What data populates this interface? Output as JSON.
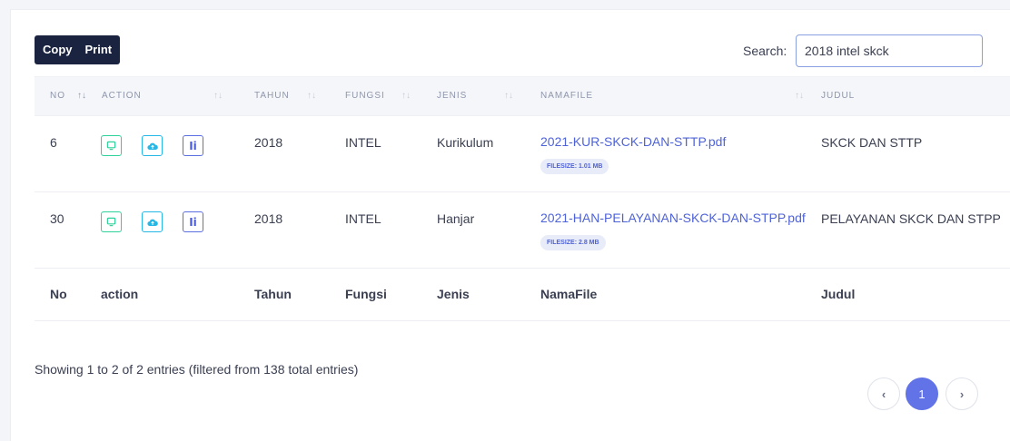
{
  "toolbar": {
    "copy_label": "Copy",
    "print_label": "Print"
  },
  "search": {
    "label": "Search:",
    "value": "2018 intel skck"
  },
  "table": {
    "headers": [
      "NO",
      "ACTION",
      "TAHUN",
      "FUNGSI",
      "JENIS",
      "NAMAFILE",
      "JUDUL"
    ],
    "rows": [
      {
        "no": "6",
        "tahun": "2018",
        "fungsi": "INTEL",
        "jenis": "Kurikulum",
        "namafile": "2021-KUR-SKCK-DAN-STTP.pdf",
        "filesize": "FILESIZE: 1.01 MB",
        "judul": "SKCK DAN STTP"
      },
      {
        "no": "30",
        "tahun": "2018",
        "fungsi": "INTEL",
        "jenis": "Hanjar",
        "namafile": "2021-HAN-PELAYANAN-SKCK-DAN-STPP.pdf",
        "filesize": "FILESIZE: 2.8 MB",
        "judul": "PELAYANAN SKCK DAN STPP"
      }
    ],
    "footer": [
      "No",
      "action",
      "Tahun",
      "Fungsi",
      "Jenis",
      "NamaFile",
      "Judul"
    ],
    "action_icons": [
      "monitor-icon",
      "cloud-icon",
      "info-icon"
    ],
    "info_glyph": "Ii"
  },
  "info_text": "Showing 1 to 2 of 2 entries (filtered from 138 total entries)",
  "pagination": {
    "prev": "‹",
    "current": "1",
    "next": "›"
  },
  "colors": {
    "accent": "#6173e6",
    "toolbar": "#1a2340",
    "view_icon": "#2fd39a",
    "cloud_icon": "#25b7e6",
    "info_icon": "#4a5cd8",
    "link": "#4f63d8"
  }
}
